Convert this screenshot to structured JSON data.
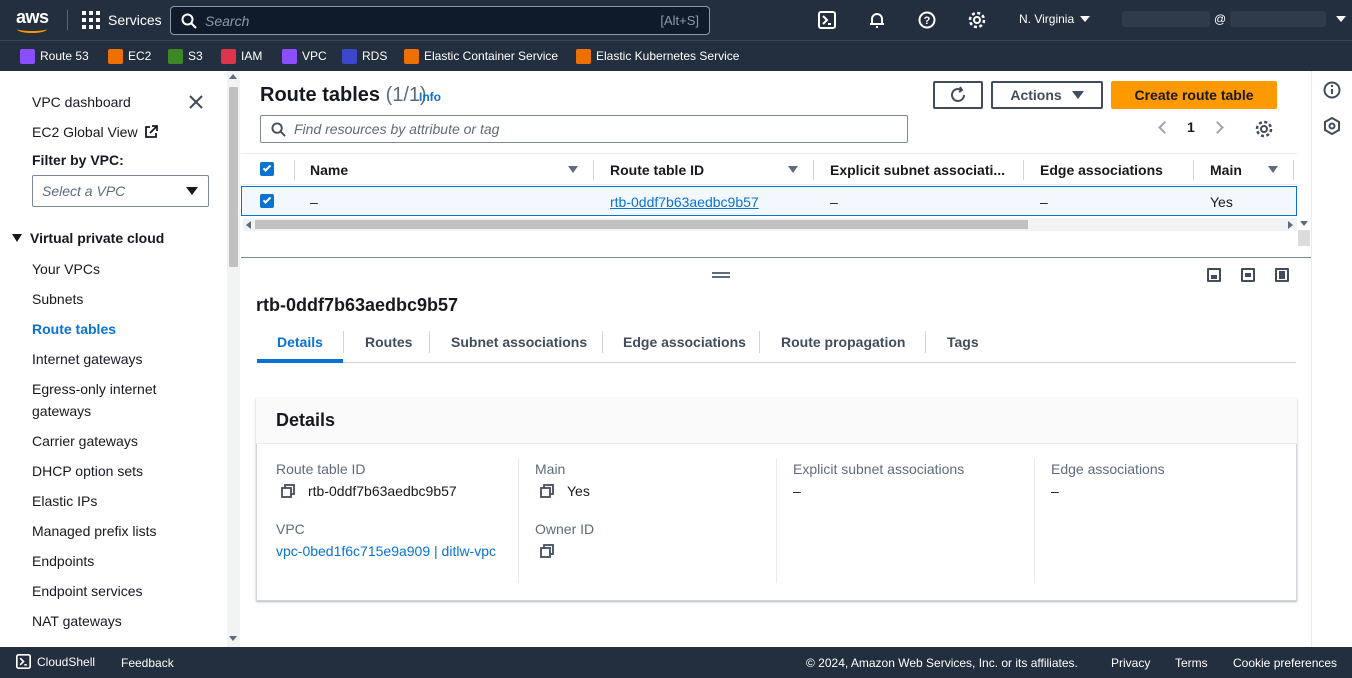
{
  "topnav": {
    "logo_text": "aws",
    "services_label": "Services",
    "search_placeholder": "Search",
    "search_shortcut": "[Alt+S]",
    "region": "N. Virginia",
    "account_at": "@"
  },
  "favorites": [
    {
      "label": "Route 53",
      "color": "#8c4fff"
    },
    {
      "label": "EC2",
      "color": "#ed7100"
    },
    {
      "label": "S3",
      "color": "#3f8624"
    },
    {
      "label": "IAM",
      "color": "#dd344c"
    },
    {
      "label": "VPC",
      "color": "#8c4fff"
    },
    {
      "label": "RDS",
      "color": "#3b48cc"
    },
    {
      "label": "Elastic Container Service",
      "color": "#ed7100"
    },
    {
      "label": "Elastic Kubernetes Service",
      "color": "#ed7100"
    }
  ],
  "sidebar": {
    "vpc_dashboard": "VPC dashboard",
    "ec2_global_view": "EC2 Global View",
    "filter_label": "Filter by VPC:",
    "filter_placeholder": "Select a VPC",
    "section_title": "Virtual private cloud",
    "items": [
      {
        "label": "Your VPCs"
      },
      {
        "label": "Subnets"
      },
      {
        "label": "Route tables"
      },
      {
        "label": "Internet gateways"
      },
      {
        "label": "Egress-only internet"
      },
      {
        "label": "gateways"
      },
      {
        "label": "Carrier gateways"
      },
      {
        "label": "DHCP option sets"
      },
      {
        "label": "Elastic IPs"
      },
      {
        "label": "Managed prefix lists"
      },
      {
        "label": "Endpoints"
      },
      {
        "label": "Endpoint services"
      },
      {
        "label": "NAT gateways"
      }
    ]
  },
  "main": {
    "title": "Route tables",
    "count": "(1/1)",
    "info": "Info",
    "actions_label": "Actions",
    "create_label": "Create route table",
    "search_placeholder": "Find resources by attribute or tag",
    "page_number": "1",
    "columns": [
      "Name",
      "Route table ID",
      "Explicit subnet associati...",
      "Edge associations",
      "Main"
    ],
    "row": {
      "name": "–",
      "route_table_id": "rtb-0ddf7b63aedbc9b57",
      "explicit_subnet": "–",
      "edge": "–",
      "main": "Yes"
    }
  },
  "detail": {
    "title": "rtb-0ddf7b63aedbc9b57",
    "tabs": [
      "Details",
      "Routes",
      "Subnet associations",
      "Edge associations",
      "Route propagation",
      "Tags"
    ],
    "card_title": "Details",
    "route_table_id_label": "Route table ID",
    "route_table_id_value": "rtb-0ddf7b63aedbc9b57",
    "main_label": "Main",
    "main_value": "Yes",
    "explicit_label": "Explicit subnet associations",
    "explicit_value": "–",
    "edge_label": "Edge associations",
    "edge_value": "–",
    "vpc_label": "VPC",
    "vpc_value": "vpc-0bed1f6c715e9a909 | ditlw-vpc",
    "owner_label": "Owner ID"
  },
  "footer": {
    "cloudshell": "CloudShell",
    "feedback": "Feedback",
    "copyright": "© 2024, Amazon Web Services, Inc. or its affiliates.",
    "privacy": "Privacy",
    "terms": "Terms",
    "cookies": "Cookie preferences"
  }
}
